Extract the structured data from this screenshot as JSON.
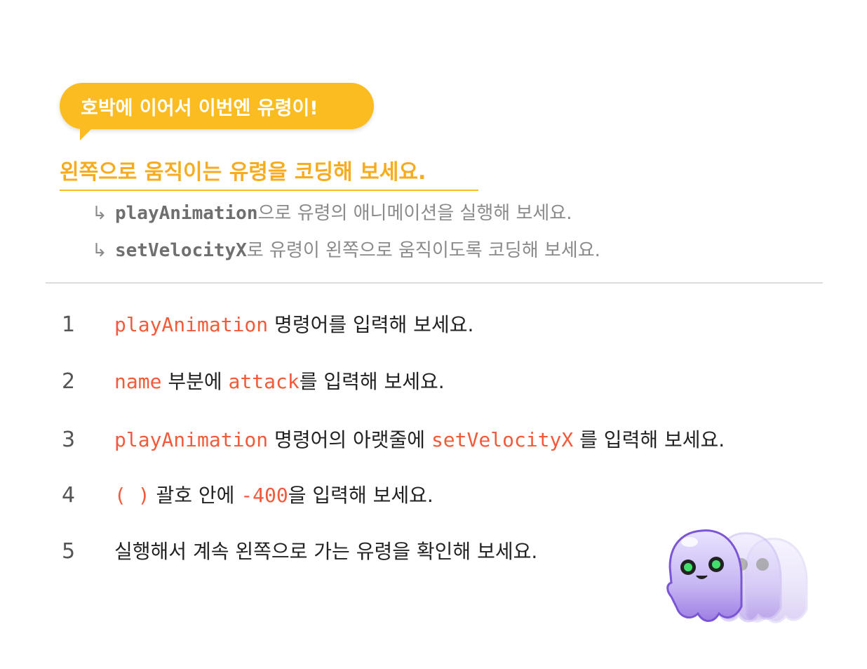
{
  "bubble": {
    "text": "호박에 이어서 이번엔 유령이!"
  },
  "heading": {
    "text": "왼쪽으로 움직이는 유령을 코딩해 보세요."
  },
  "subpoints": [
    {
      "arrow": "↳",
      "code": "playAnimation",
      "text": "으로 유령의 애니메이션을 실행해 보세요."
    },
    {
      "arrow": "↳",
      "code": "setVelocityX",
      "text": "로 유령이 왼쪽으로 움직이도록 코딩해 보세요."
    }
  ],
  "steps": [
    {
      "num": "1",
      "parts": {
        "a": "playAnimation",
        "b": " 명령어를 입력해 보세요."
      }
    },
    {
      "num": "2",
      "parts": {
        "a": "name",
        "b": " 부분에 ",
        "c": "attack",
        "d": "를 입력해 보세요."
      }
    },
    {
      "num": "3",
      "parts": {
        "a": "playAnimation",
        "b": " 명령어의 아랫줄에 ",
        "c": "setVelocityX",
        "d": " 를 입력해 보세요."
      }
    },
    {
      "num": "4",
      "parts": {
        "a": "( )",
        "b": " 괄호 안에 ",
        "c": "-400",
        "d": "을 입력해 보세요."
      }
    },
    {
      "num": "5",
      "parts": {
        "a": "실행해서 계속 왼쪽으로 가는 유령을 확인해 보세요."
      }
    }
  ],
  "colors": {
    "accent": "#fbbc22",
    "code": "#f25a3a",
    "ghost": "#a98ae6"
  }
}
